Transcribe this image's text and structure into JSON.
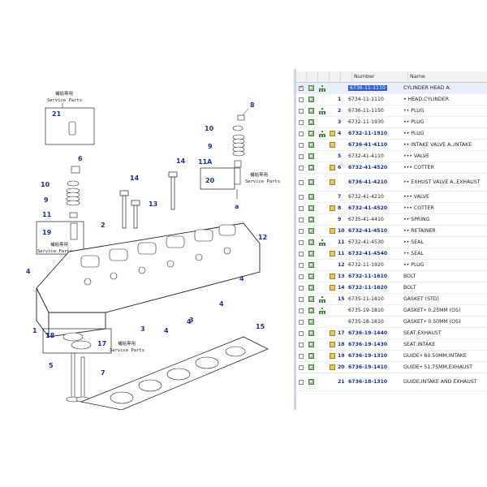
{
  "table": {
    "columns": [
      "",
      "",
      "",
      "",
      "",
      "Number",
      "Name"
    ],
    "rows": [
      {
        "checked": true,
        "tree": true,
        "box": false,
        "num": "",
        "part": "6736-11-1110",
        "part_bold": false,
        "name": "CYLINDER HEAD A.",
        "selected": true
      },
      {
        "checked": false,
        "tree": false,
        "box": false,
        "num": "1",
        "part": "6734-11-1110",
        "part_bold": false,
        "name": "• HEAD,CYLINDER"
      },
      {
        "checked": false,
        "tree": true,
        "box": false,
        "num": "2",
        "part": "6736-11-1150",
        "part_bold": false,
        "name": "•• PLUG"
      },
      {
        "checked": false,
        "tree": false,
        "box": false,
        "num": "3",
        "part": "6732-11-1930",
        "part_bold": false,
        "name": "•• PLUG"
      },
      {
        "checked": false,
        "tree": true,
        "box": true,
        "num": "4",
        "part": "6732-11-1910",
        "part_bold": true,
        "name": "•• PLUG"
      },
      {
        "checked": false,
        "tree": false,
        "box": true,
        "num": "",
        "part": "6736-41-4110",
        "part_bold": true,
        "name": "•• INTAKE VALVE A.,INTAKE"
      },
      {
        "checked": false,
        "tree": false,
        "box": false,
        "num": "5",
        "part": "6732-41-4110",
        "part_bold": false,
        "name": "••• VALVE"
      },
      {
        "checked": false,
        "tree": false,
        "box": true,
        "num": "6",
        "part": "6732-41-4520",
        "part_bold": true,
        "name": "••• COTTER"
      },
      {
        "checked": false,
        "tree": false,
        "box": true,
        "num": "",
        "part": "6736-41-4210",
        "part_bold": true,
        "name": "•• EXHUST VALVE A.,EXHAUST",
        "tall": true
      },
      {
        "checked": false,
        "tree": false,
        "box": false,
        "num": "7",
        "part": "6732-41-4210",
        "part_bold": false,
        "name": "••• VALVE"
      },
      {
        "checked": false,
        "tree": false,
        "box": true,
        "num": "8",
        "part": "6732-41-4520",
        "part_bold": true,
        "name": "••• COTTER"
      },
      {
        "checked": false,
        "tree": false,
        "box": false,
        "num": "9",
        "part": "6735-41-4410",
        "part_bold": false,
        "name": "•• SPRING"
      },
      {
        "checked": false,
        "tree": false,
        "box": true,
        "num": "10",
        "part": "6732-41-4510",
        "part_bold": true,
        "name": "•• RETAINER"
      },
      {
        "checked": false,
        "tree": true,
        "box": false,
        "num": "11",
        "part": "6732-41-4530",
        "part_bold": false,
        "name": "•• SEAL"
      },
      {
        "checked": false,
        "tree": false,
        "box": true,
        "num": "11",
        "part": "6732-41-4540",
        "part_bold": true,
        "name": "•• SEAL"
      },
      {
        "checked": false,
        "tree": false,
        "box": false,
        "num": "12",
        "part": "6732-11-1920",
        "part_bold": false,
        "name": "•• PLUG"
      },
      {
        "checked": false,
        "tree": false,
        "box": true,
        "num": "13",
        "part": "6732-11-1610",
        "part_bold": true,
        "name": "BOLT"
      },
      {
        "checked": false,
        "tree": false,
        "box": true,
        "num": "14",
        "part": "6732-11-1620",
        "part_bold": true,
        "name": "BOLT"
      },
      {
        "checked": false,
        "tree": true,
        "box": false,
        "num": "15",
        "part": "6735-11-1810",
        "part_bold": false,
        "name": "GASKET (STD)"
      },
      {
        "checked": false,
        "tree": true,
        "box": false,
        "num": "",
        "part": "6735-19-1810",
        "part_bold": false,
        "name": "GASKET• 0.25MM (OS)"
      },
      {
        "checked": false,
        "tree": false,
        "box": false,
        "num": "",
        "part": "6735-18-1810",
        "part_bold": false,
        "name": "GASKET• 0.50MM (OS)"
      },
      {
        "checked": false,
        "tree": false,
        "box": true,
        "num": "17",
        "part": "6736-19-1440",
        "part_bold": true,
        "name": "SEAT,EXHAUST"
      },
      {
        "checked": false,
        "tree": false,
        "box": true,
        "num": "18",
        "part": "6736-19-1430",
        "part_bold": true,
        "name": "SEAT,INTAKE"
      },
      {
        "checked": false,
        "tree": false,
        "box": true,
        "num": "19",
        "part": "6736-19-1310",
        "part_bold": true,
        "name": "GUIDE• 60.50MM,INTAKE"
      },
      {
        "checked": false,
        "tree": false,
        "box": true,
        "num": "20",
        "part": "6736-19-1410",
        "part_bold": true,
        "name": "GUIDE• 51.75MM,EXHAUST"
      },
      {
        "checked": false,
        "tree": false,
        "box": false,
        "num": "21",
        "part": "6736-18-1310",
        "part_bold": true,
        "name": "GUIDE,INTAKE AND EXHAUST",
        "tall": true
      }
    ]
  },
  "diagram": {
    "service_jp": "補給専用",
    "service_en": "Service Parts",
    "callouts": [
      "21",
      "8",
      "10",
      "9",
      "6",
      "11A",
      "20",
      "10",
      "9",
      "11",
      "19",
      "14",
      "14",
      "13",
      "2",
      "12",
      "4",
      "4",
      "4",
      "4",
      "3",
      "4",
      "3",
      "1",
      "18",
      "17",
      "5",
      "7",
      "15",
      "a",
      "a"
    ]
  }
}
